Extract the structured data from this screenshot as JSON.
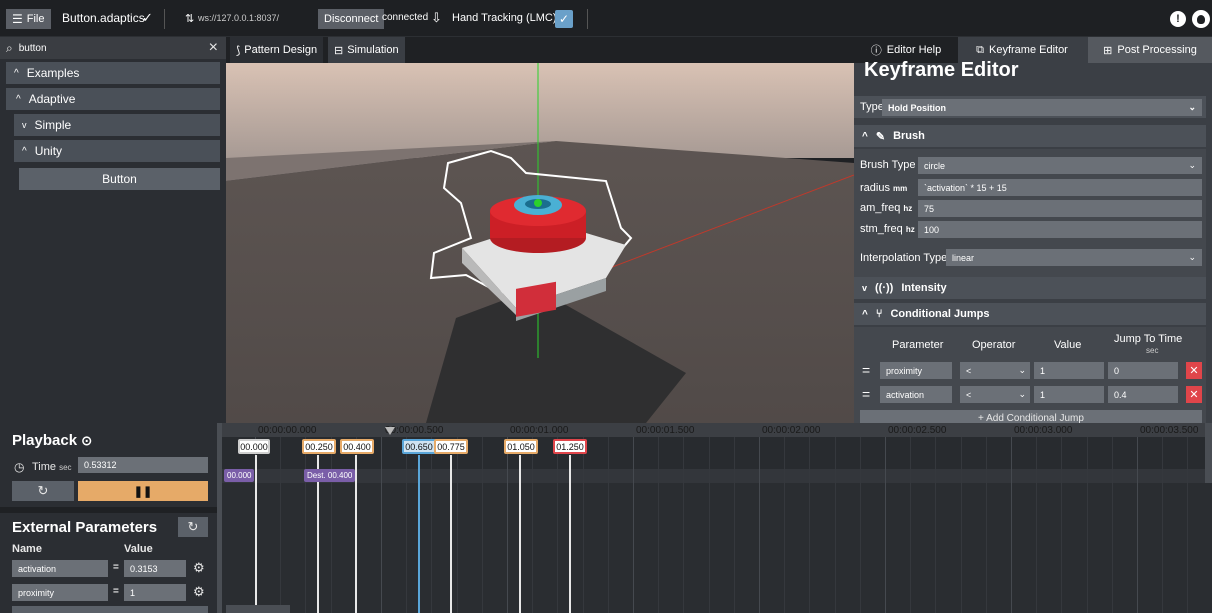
{
  "topbar": {
    "file_label": "File",
    "project_name": "Button.adaptics",
    "ws_address": "ws://127.0.0.1:8037/",
    "disconnect_label": "Disconnect",
    "connected_label": "connected",
    "hand_tracking_label": "Hand Tracking (LMC):"
  },
  "left": {
    "search_value": "button",
    "examples_label": "Examples",
    "adaptive_label": "Adaptive",
    "simple_label": "Simple",
    "unity_label": "Unity",
    "button_label": "Button"
  },
  "tabs": {
    "pattern_design": "Pattern Design",
    "simulation": "Simulation"
  },
  "right": {
    "tabs": {
      "editor_help": "Editor Help",
      "keyframe_editor": "Keyframe Editor",
      "post_processing": "Post Processing"
    },
    "title": "Keyframe Editor",
    "type_label": "Type",
    "type_value": "Hold Position",
    "brush_section": "Brush",
    "brush_type_label": "Brush Type",
    "brush_type_value": "circle",
    "radius_label": "radius",
    "radius_unit": "mm",
    "radius_value": "`activation` * 15 + 15",
    "am_freq_label": "am_freq",
    "am_freq_unit": "hz",
    "am_freq_value": "75",
    "stm_freq_label": "stm_freq",
    "stm_freq_unit": "hz",
    "stm_freq_value": "100",
    "interp_label": "Interpolation Type",
    "interp_value": "linear",
    "intensity_section": "Intensity",
    "jumps_section": "Conditional Jumps",
    "jumps_headers": {
      "parameter": "Parameter",
      "operator": "Operator",
      "value": "Value",
      "jump_to_time": "Jump To Time",
      "jump_unit": "sec"
    },
    "jumps": [
      {
        "param": "proximity",
        "op": "<",
        "value": "1",
        "time": "0"
      },
      {
        "param": "activation",
        "op": "<",
        "value": "1",
        "time": "0.4"
      }
    ],
    "add_jump_label": "+ Add Conditional Jump"
  },
  "playback": {
    "title": "Playback",
    "time_label": "Time",
    "time_unit": "sec",
    "time_value": "0.53312",
    "ext_title": "External Parameters",
    "name_header": "Name",
    "value_header": "Value",
    "params": [
      {
        "name": "activation",
        "value": "0.3153"
      },
      {
        "name": "proximity",
        "value": "1"
      }
    ]
  },
  "timeline": {
    "ruler": [
      "00:00:00.000",
      "00:00:00.500",
      "00:00:01.000",
      "00:00:01.500",
      "00:00:02.000",
      "00:00:02.500",
      "00:00:03.000",
      "00:00:03.500"
    ],
    "keyframes": [
      "00.000",
      "00.250",
      "00.400",
      "00.650",
      "00.775",
      "01.050",
      "01.250"
    ],
    "start_marker": "00.000",
    "dest_marker": "Dest. 00.400"
  }
}
